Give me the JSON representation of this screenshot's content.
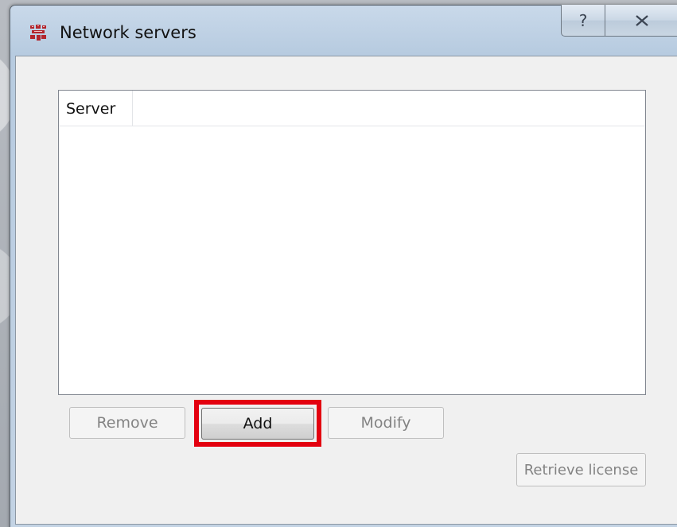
{
  "window": {
    "title": "Network servers",
    "app_icon": "app-logo-icon",
    "help_button_glyph": "?",
    "close_button_glyph": "X"
  },
  "server_list": {
    "columns": [
      "Server"
    ],
    "rows": []
  },
  "buttons": {
    "remove_label": "Remove",
    "add_label": "Add",
    "modify_label": "Modify",
    "retrieve_license_label": "Retrieve license"
  },
  "states": {
    "remove_enabled": false,
    "add_enabled": true,
    "modify_enabled": false,
    "retrieve_license_enabled": false
  },
  "annotation": {
    "highlight_color": "#e3000f",
    "highlighted_element": "Add"
  }
}
